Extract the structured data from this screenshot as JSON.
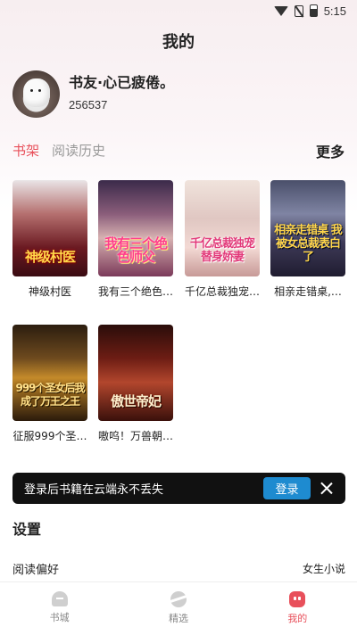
{
  "status_bar": {
    "time": "5:15"
  },
  "header": {
    "title": "我的"
  },
  "user": {
    "name": "书友·心已疲倦。",
    "id": "256537"
  },
  "tabs": [
    {
      "label": "书架",
      "active": true
    },
    {
      "label": "阅读历史",
      "active": false
    }
  ],
  "more_label": "更多",
  "books": [
    {
      "title": "神级村医",
      "cover_text": "神级村医"
    },
    {
      "title": "我有三个绝色…",
      "cover_text": "我有三个绝色师父"
    },
    {
      "title": "千亿总裁独宠…",
      "cover_text": "千亿总裁独宠替身娇妻"
    },
    {
      "title": "相亲走错桌,…",
      "cover_text": "相亲走错桌 我被女总裁表白了"
    },
    {
      "title": "征服999个圣…",
      "cover_text": "999个圣女后我成了万王之王"
    },
    {
      "title": "嗷呜！万兽朝…",
      "cover_text": "傲世帝妃"
    }
  ],
  "login_banner": {
    "text": "登录后书籍在云端永不丢失",
    "button": "登录"
  },
  "settings": {
    "title": "设置",
    "reading_pref_label": "阅读偏好",
    "reading_pref_value": "女生小说"
  },
  "bottom_nav": [
    {
      "label": "书城",
      "icon": "home-icon",
      "active": false
    },
    {
      "label": "精选",
      "icon": "planet-icon",
      "active": false
    },
    {
      "label": "我的",
      "icon": "mine-icon",
      "active": true
    }
  ],
  "colors": {
    "accent": "#e8505b",
    "login_button": "#1e8bd0",
    "banner_bg": "#111111"
  }
}
